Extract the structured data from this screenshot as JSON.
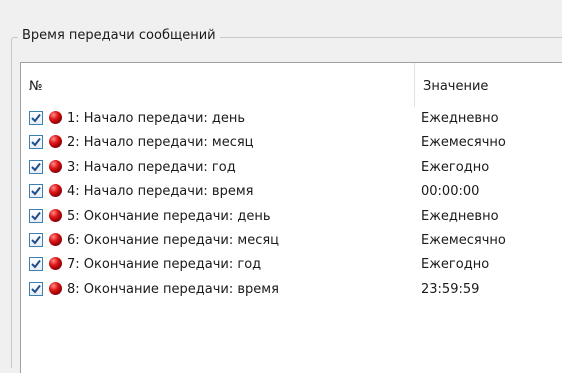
{
  "groupbox": {
    "title": "Время передачи сообщений"
  },
  "table": {
    "columns": {
      "number": "№",
      "value": "Значение"
    },
    "rows": [
      {
        "label": "1: Начало передачи: день",
        "value": "Ежедневно",
        "checked": true
      },
      {
        "label": "2: Начало передачи: месяц",
        "value": "Ежемесячно",
        "checked": true
      },
      {
        "label": "3: Начало передачи: год",
        "value": "Ежегодно",
        "checked": true
      },
      {
        "label": "4: Начало передачи: время",
        "value": "00:00:00",
        "checked": true
      },
      {
        "label": "5: Окончание передачи: день",
        "value": "Ежедневно",
        "checked": true
      },
      {
        "label": "6: Окончание передачи: месяц",
        "value": "Ежемесячно",
        "checked": true
      },
      {
        "label": "7: Окончание передачи: год",
        "value": "Ежегодно",
        "checked": true
      },
      {
        "label": "8: Окончание передачи: время",
        "value": "23:59:59",
        "checked": true
      }
    ]
  },
  "icons": {
    "row_icon": "red-ball-icon",
    "checkbox_icon": "checkmark-icon"
  },
  "colors": {
    "checkbox_border": "#3c7fb1",
    "checkmark": "#1f4f8a",
    "ball_red": "#e01818"
  }
}
